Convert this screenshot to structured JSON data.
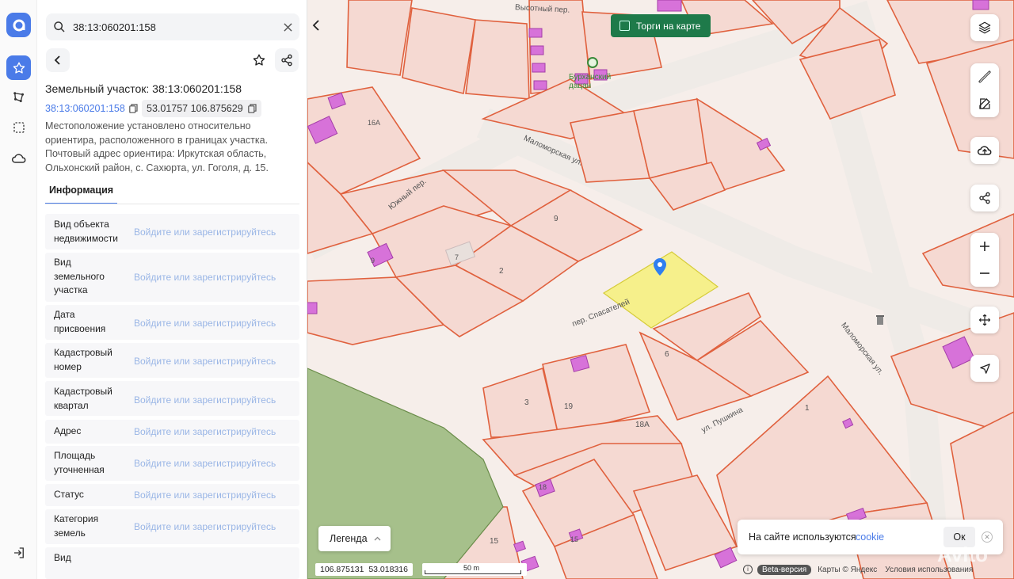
{
  "rail": {
    "logo": "app-logo",
    "items": [
      "star-icon",
      "polygon-icon",
      "selection-icon",
      "cloud-icon"
    ],
    "bottom": "logout-icon"
  },
  "search": {
    "value": "38:13:060201:158"
  },
  "object": {
    "title": "Земельный участок: 38:13:060201:158",
    "cadastral_number": "38:13:060201:158",
    "coordinates": "53.01757 106.875629",
    "description": "Местоположение установлено относительно ориентира, расположенного в границах участка. Почтовый адрес ориентира: Иркутская область, Ольхонский район, с. Сахюрта, ул. Гоголя, д. 15."
  },
  "tabs": {
    "info": "Информация"
  },
  "login_prompt": "Войдите или зарегистрируйтесь",
  "rows": [
    {
      "label": "Вид объекта недвижимости"
    },
    {
      "label": "Вид земельного участка"
    },
    {
      "label": "Дата присвоения"
    },
    {
      "label": "Кадастровый номер"
    },
    {
      "label": "Кадастровый квартал"
    },
    {
      "label": "Адрес"
    },
    {
      "label": "Площадь уточненная"
    },
    {
      "label": "Статус"
    },
    {
      "label": "Категория земель"
    },
    {
      "label": "Вид"
    }
  ],
  "map": {
    "torgi_label": "Торги на карте",
    "legend_label": "Легенда",
    "coords_left": "106.875131",
    "coords_right": "53.018316",
    "scale_label": "50 m",
    "streets": {
      "vysotny": "Высотный пер.",
      "malomorskaya1": "Маломорская ул.",
      "malomorskaya2": "Маломорская ул.",
      "yuzhny": "Южный пер.",
      "spasateley": "пер. Спасателей",
      "pushkina": "ул. Пушкина"
    },
    "poi": "Бурханский дацан",
    "parcel_numbers": [
      "9",
      "2",
      "6",
      "3",
      "19",
      "18А",
      "1",
      "15",
      "7",
      "9",
      "18",
      "16А",
      "15"
    ],
    "cookie_text": "На сайте используются",
    "cookie_link": "cookie",
    "cookie_ok": "Ок",
    "beta": "Beta-версия",
    "yandex": "Карты © Яндекс",
    "terms": "Условия использования",
    "watermark": "Avito",
    "colors": {
      "parcel_fill": "#f5d9d2",
      "parcel_stroke": "#e0613e",
      "building": "#d772d9",
      "selected": "#f6f07a",
      "forest": "#a6c08b",
      "road": "#f4f2ef"
    }
  }
}
